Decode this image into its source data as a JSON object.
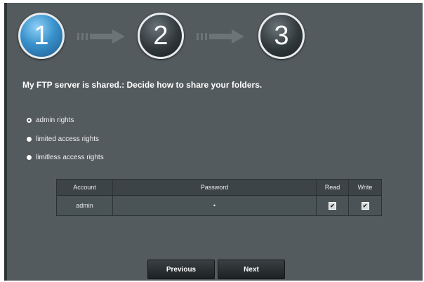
{
  "steps": [
    {
      "number": "1",
      "state": "active"
    },
    {
      "number": "2",
      "state": "inactive"
    },
    {
      "number": "3",
      "state": "inactive"
    }
  ],
  "title": "My FTP server is shared.: Decide how to share your folders.",
  "rights_options": [
    {
      "label": "admin rights",
      "selected": true
    },
    {
      "label": "limited access rights",
      "selected": false
    },
    {
      "label": "limitless access rights",
      "selected": false
    }
  ],
  "table": {
    "headers": {
      "account": "Account",
      "password": "Password",
      "read": "Read",
      "write": "Write"
    },
    "rows": [
      {
        "account": "admin",
        "password": "•",
        "read": "✔",
        "write": "✔"
      }
    ]
  },
  "buttons": {
    "previous": "Previous",
    "next": "Next"
  },
  "colors": {
    "accent": "#3a92cc",
    "panel": "#535b5e"
  }
}
